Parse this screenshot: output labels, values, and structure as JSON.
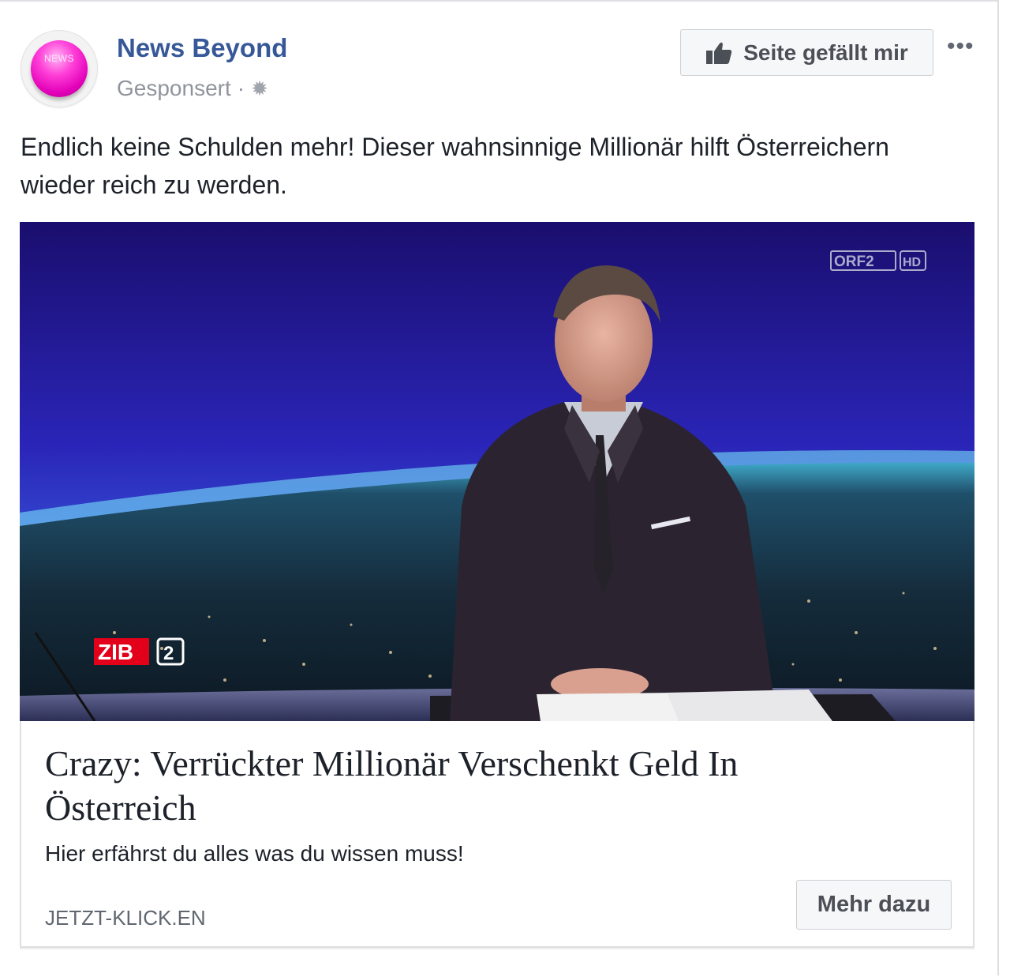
{
  "post": {
    "page_name": "News Beyond",
    "avatar_text": "NEWS",
    "sponsored_label": "Gesponsert",
    "separator": "·",
    "like_button_label": "Seite gefällt mir",
    "more_icon": "more-horizontal-icon",
    "text": "Endlich keine Schulden mehr! Dieser wahnsinnige Millionär hilft Österreichern wieder reich zu werden."
  },
  "media": {
    "channel_logo": "ORF2",
    "channel_logo_hd": "HD",
    "show_logo": "ZIB",
    "show_logo_number": "2"
  },
  "link_card": {
    "title": "Crazy: Verrückter Millionär Verschenkt Geld In Österreich",
    "description": "Hier erfährst du alles was du wissen muss!",
    "domain": "JETZT-KLICK.EN",
    "cta_label": "Mehr dazu"
  },
  "colors": {
    "page_name": "#365899",
    "text": "#1d2129",
    "muted": "#90949c",
    "button_bg": "#f6f7f9",
    "button_border": "#ced0d4",
    "zib_red": "#e2001a"
  }
}
